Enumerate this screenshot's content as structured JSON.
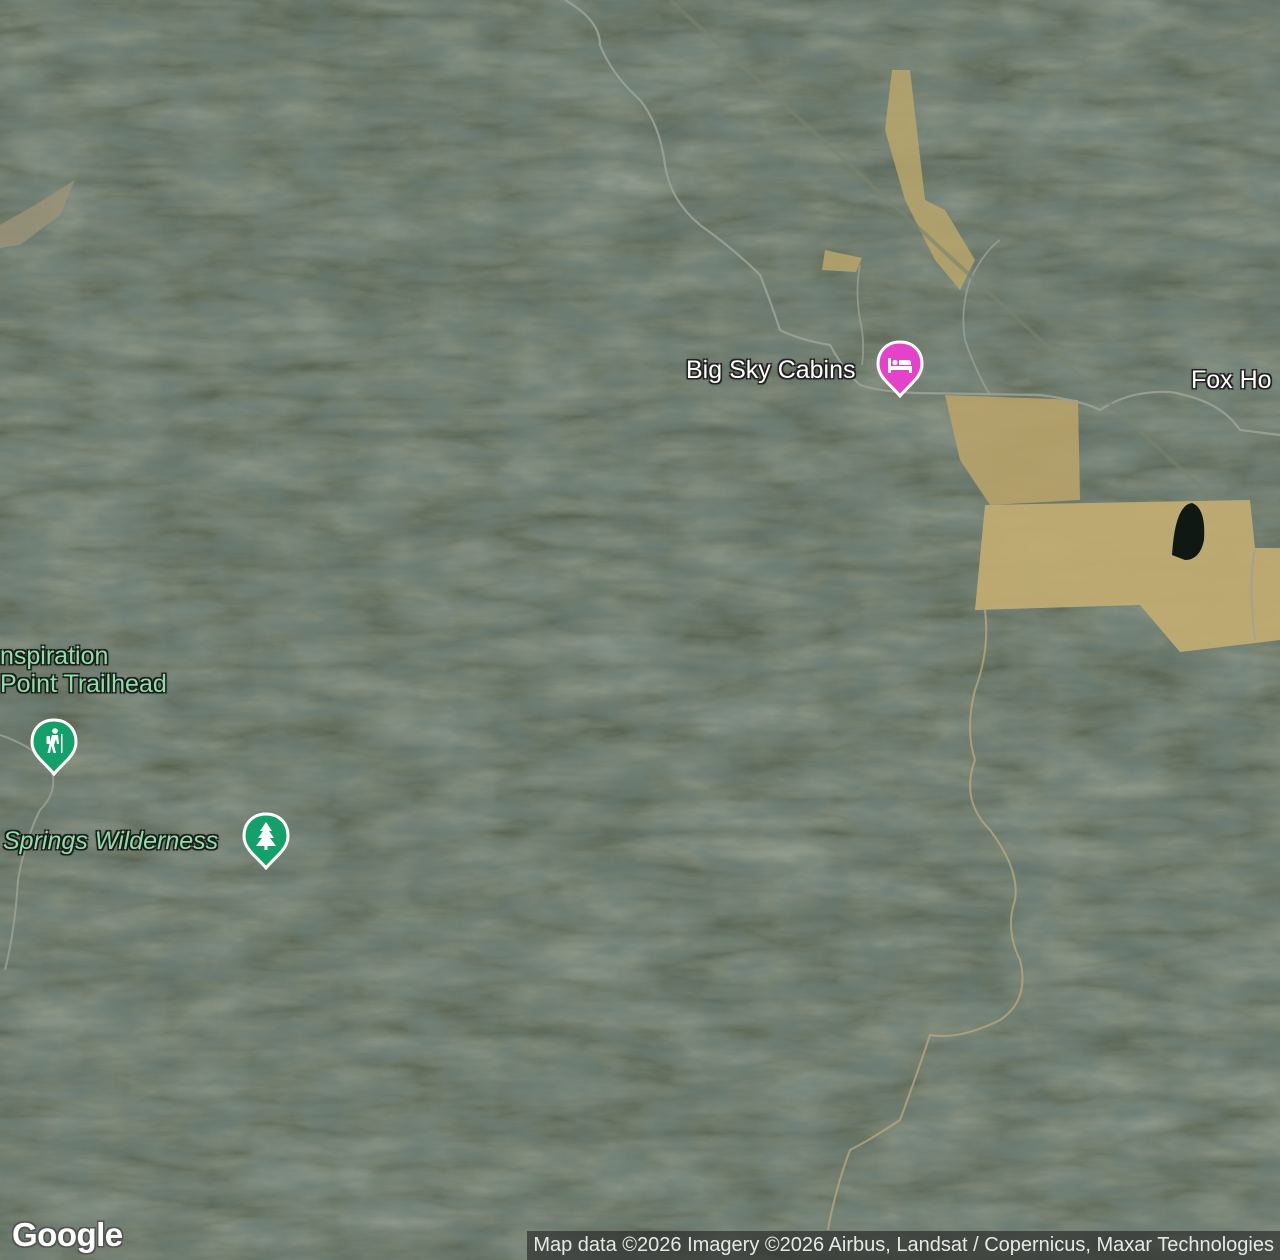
{
  "map": {
    "view": "satellite",
    "places": [
      {
        "id": "big-sky-cabins",
        "name": "Big Sky Cabins",
        "category": "lodging",
        "icon": "bed-icon",
        "color": "#e443c9"
      },
      {
        "id": "fox-hollow",
        "name": "Fox Ho",
        "category": "road-label"
      },
      {
        "id": "inspiration-point-trailhead",
        "name_line1": "nspiration",
        "name_line2": "Point Trailhead",
        "category": "trailhead",
        "icon": "hiker-icon",
        "color": "#14a06a"
      },
      {
        "id": "springs-wilderness",
        "name": "Springs Wilderness",
        "category": "park",
        "icon": "tree-icon",
        "color": "#14a06a"
      }
    ]
  },
  "branding": {
    "logo_text": "Google"
  },
  "attribution": {
    "text": "Map data ©2026 Imagery ©2026 Airbus, Landsat / Copernicus, Maxar Technologies"
  }
}
